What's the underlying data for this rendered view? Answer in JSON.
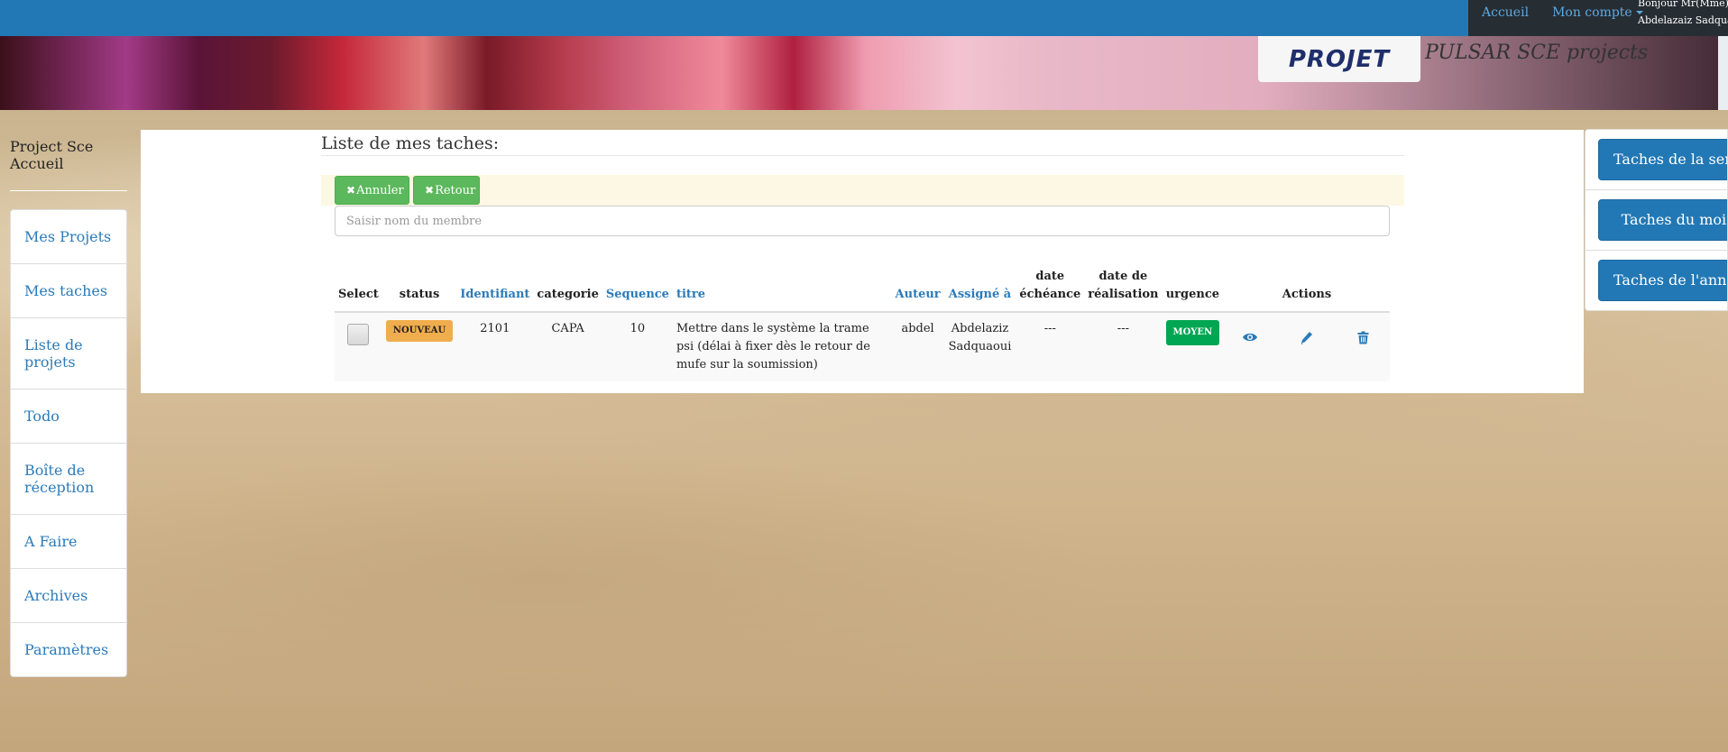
{
  "navbar": {
    "accueil": "Accueil",
    "mon_compte": "Mon compte",
    "greeting": "Bonjour Mr(Mme)",
    "user_name": "Abdelazaiz Sadquaoui"
  },
  "banner": {
    "logo_text": "PROJET",
    "brand_title": "PULSAR SCE projects"
  },
  "sidebar": {
    "title": "Project Sce Accueil",
    "items": [
      {
        "label": "Mes Projets"
      },
      {
        "label": "Mes taches"
      },
      {
        "label": "Liste de projets"
      },
      {
        "label": "Todo"
      },
      {
        "label": "Boîte de réception"
      },
      {
        "label": "A Faire"
      },
      {
        "label": "Archives"
      },
      {
        "label": "Paramètres"
      }
    ]
  },
  "main": {
    "title": "Liste de mes taches:",
    "buttons": {
      "annuler": "Annuler",
      "retour": "Retour"
    },
    "search_placeholder": "Saisir nom du membre",
    "table": {
      "headers": {
        "select": "Select",
        "status": "status",
        "identifiant": "Identifiant",
        "categorie": "categorie",
        "sequence": "Sequence",
        "titre": "titre",
        "auteur": "Auteur",
        "assigne": "Assigné à",
        "date_echeance": "date échéance",
        "date_realisation": "date de réalisation",
        "urgence": "urgence",
        "actions": "Actions"
      },
      "rows": [
        {
          "status": "NOUVEAU",
          "identifiant": "2101",
          "categorie": "CAPA",
          "sequence": "10",
          "titre": "Mettre dans le système la trame psi (délai à fixer dès le retour de mufe sur la soumission)",
          "auteur": "abdel",
          "assigne": "Abdelaziz Sadquaoui",
          "date_echeance": "---",
          "date_realisation": "---",
          "urgence": "MOYEN"
        }
      ]
    }
  },
  "right_panel": {
    "items": [
      {
        "label": "Taches de la semaine"
      },
      {
        "label": "Taches du mois"
      },
      {
        "label": "Taches de l'année"
      }
    ]
  },
  "colors": {
    "navbar": "#2278b5",
    "link": "#2b7bb9",
    "status_nouveau": "#f0ad4e",
    "urgence_moyen": "#00a651",
    "button_green": "#5cb85c"
  },
  "icons": [
    "view-eye-icon",
    "edit-pencil-icon",
    "delete-trash-icon",
    "close-x-icon",
    "caret-down-icon",
    "project-logo"
  ]
}
